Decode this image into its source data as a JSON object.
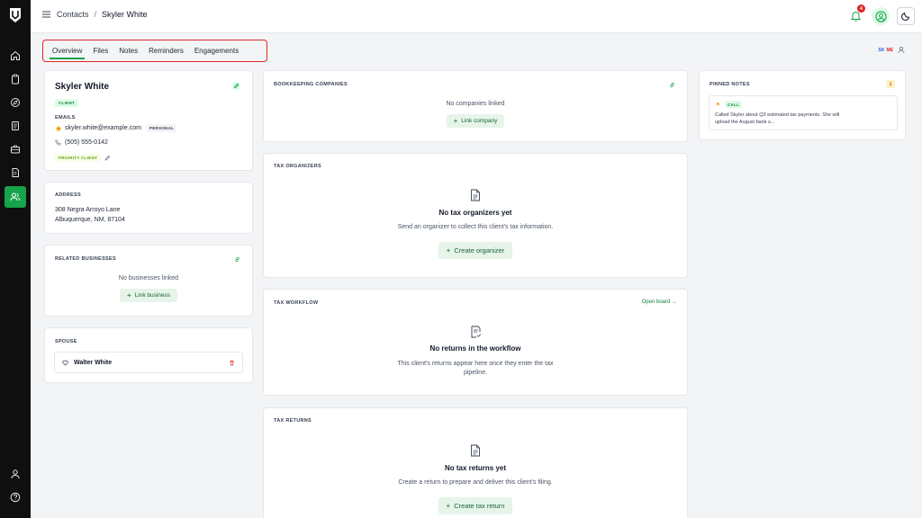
{
  "breadcrumb": {
    "parent": "Contacts",
    "separator": "/",
    "current": "Skyler White"
  },
  "notifications": {
    "count": "4"
  },
  "tabs": [
    {
      "label": "Overview"
    },
    {
      "label": "Files"
    },
    {
      "label": "Notes"
    },
    {
      "label": "Reminders"
    },
    {
      "label": "Engagements"
    }
  ],
  "presence": {
    "user1": "SK",
    "user2": "ME"
  },
  "contact": {
    "name": "Skyler White",
    "type_badge": "CLIENT",
    "emails_label": "EMAILS",
    "email": "skyler.white@example.com",
    "email_tag": "PERSONAL",
    "phone": "(505) 555-0142",
    "priority_tag": "PRIORITY CLIENT"
  },
  "address": {
    "label": "ADDRESS",
    "line1": "308 Negra Arroyo Lane",
    "line2": "Albuquerque, NM, 87104"
  },
  "related_businesses": {
    "label": "RELATED BUSINESSES",
    "empty": "No businesses linked",
    "button": "Link business"
  },
  "spouse": {
    "label": "SPOUSE",
    "name": "Walter White"
  },
  "bookkeeping": {
    "label": "BOOKKEEPING COMPANIES",
    "empty": "No companies linked",
    "button": "Link company"
  },
  "tax_organizers": {
    "label": "TAX ORGANIZERS",
    "empty_title": "No tax organizers yet",
    "empty_sub": "Send an organizer to collect this client's tax information.",
    "button": "Create organizer"
  },
  "tax_workflow": {
    "label": "TAX WORKFLOW",
    "link": "Open board →",
    "empty_title": "No returns in the workflow",
    "empty_sub_1": "This client's returns appear here once they enter the tax",
    "empty_sub_2": "pipeline."
  },
  "tax_returns": {
    "label": "TAX RETURNS",
    "empty_title": "No tax returns yet",
    "empty_sub": "Create a return to prepare and deliver this client's filing.",
    "button": "Create tax return"
  },
  "pinned_notes": {
    "label": "PINNED NOTES",
    "count": "1",
    "note_tag": "CALL",
    "note_line1": "Called Skyler about Q3 estimated tax payments. She will",
    "note_line2": "upload the August bank s..."
  },
  "colors": {
    "accent": "#16a34a",
    "danger": "#dc2626",
    "rail": "#0f0f10"
  }
}
